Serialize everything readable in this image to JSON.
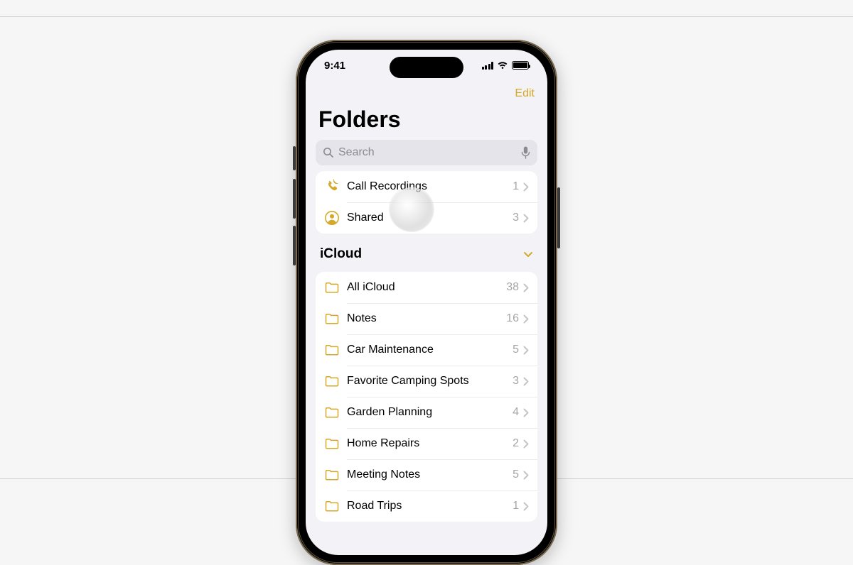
{
  "status": {
    "time": "9:41"
  },
  "nav": {
    "edit": "Edit"
  },
  "header": {
    "title": "Folders"
  },
  "search": {
    "placeholder": "Search"
  },
  "top_group": {
    "items": [
      {
        "label": "Call Recordings",
        "count": "1"
      },
      {
        "label": "Shared",
        "count": "3"
      }
    ]
  },
  "section": {
    "title": "iCloud"
  },
  "icloud": {
    "items": [
      {
        "label": "All iCloud",
        "count": "38"
      },
      {
        "label": "Notes",
        "count": "16"
      },
      {
        "label": "Car Maintenance",
        "count": "5"
      },
      {
        "label": "Favorite Camping Spots",
        "count": "3"
      },
      {
        "label": "Garden Planning",
        "count": "4"
      },
      {
        "label": "Home Repairs",
        "count": "2"
      },
      {
        "label": "Meeting Notes",
        "count": "5"
      },
      {
        "label": "Road Trips",
        "count": "1"
      }
    ]
  },
  "colors": {
    "accent": "#d4a929"
  }
}
